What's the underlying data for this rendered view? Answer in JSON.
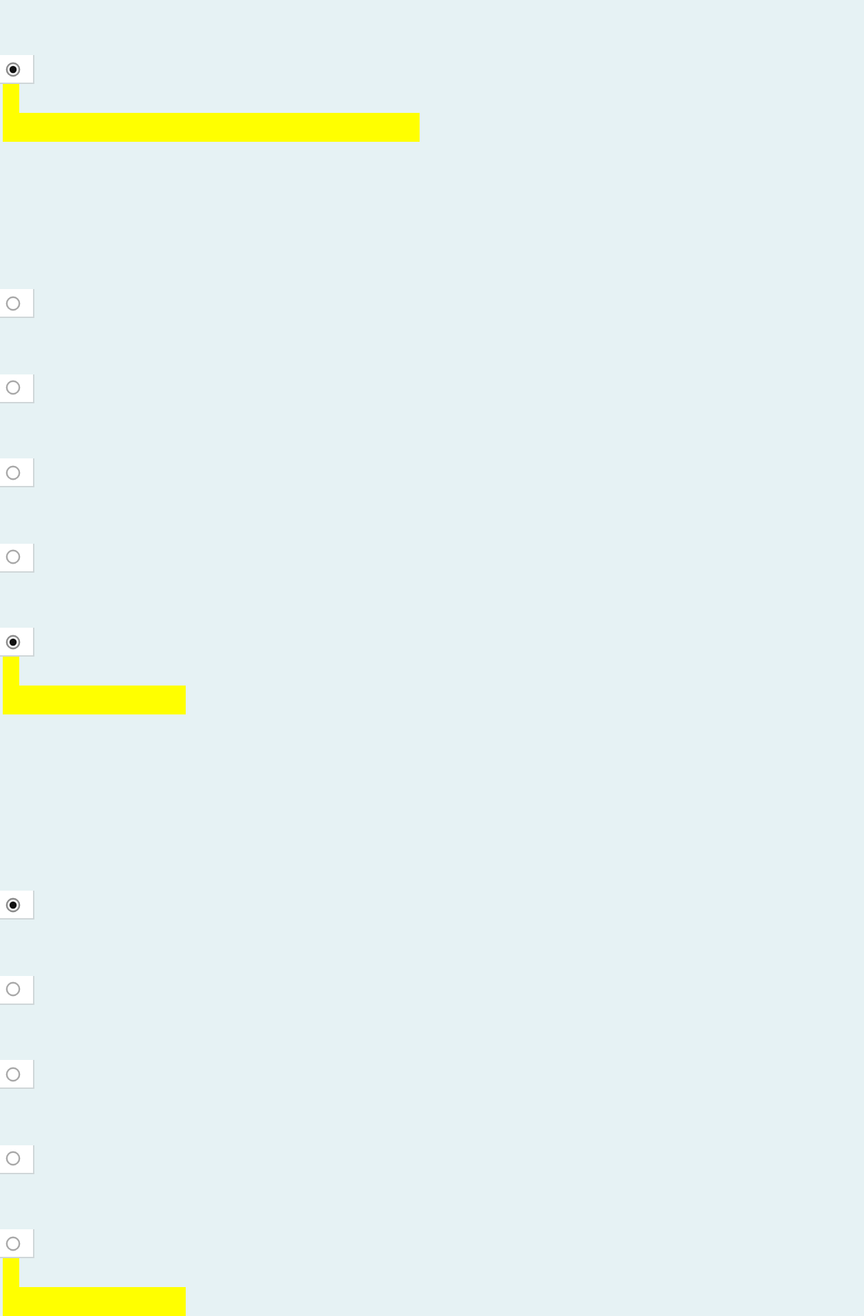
{
  "groups": [
    {
      "options": [
        {
          "selected": true,
          "highlighted": true
        }
      ]
    },
    {
      "options": [
        {
          "selected": false,
          "highlighted": false
        },
        {
          "selected": false,
          "highlighted": false
        },
        {
          "selected": false,
          "highlighted": false
        },
        {
          "selected": false,
          "highlighted": false
        },
        {
          "selected": true,
          "highlighted": true
        }
      ]
    },
    {
      "options": [
        {
          "selected": true,
          "highlighted": false
        },
        {
          "selected": false,
          "highlighted": false
        },
        {
          "selected": false,
          "highlighted": false
        },
        {
          "selected": false,
          "highlighted": false
        },
        {
          "selected": false,
          "highlighted": true
        }
      ]
    }
  ]
}
